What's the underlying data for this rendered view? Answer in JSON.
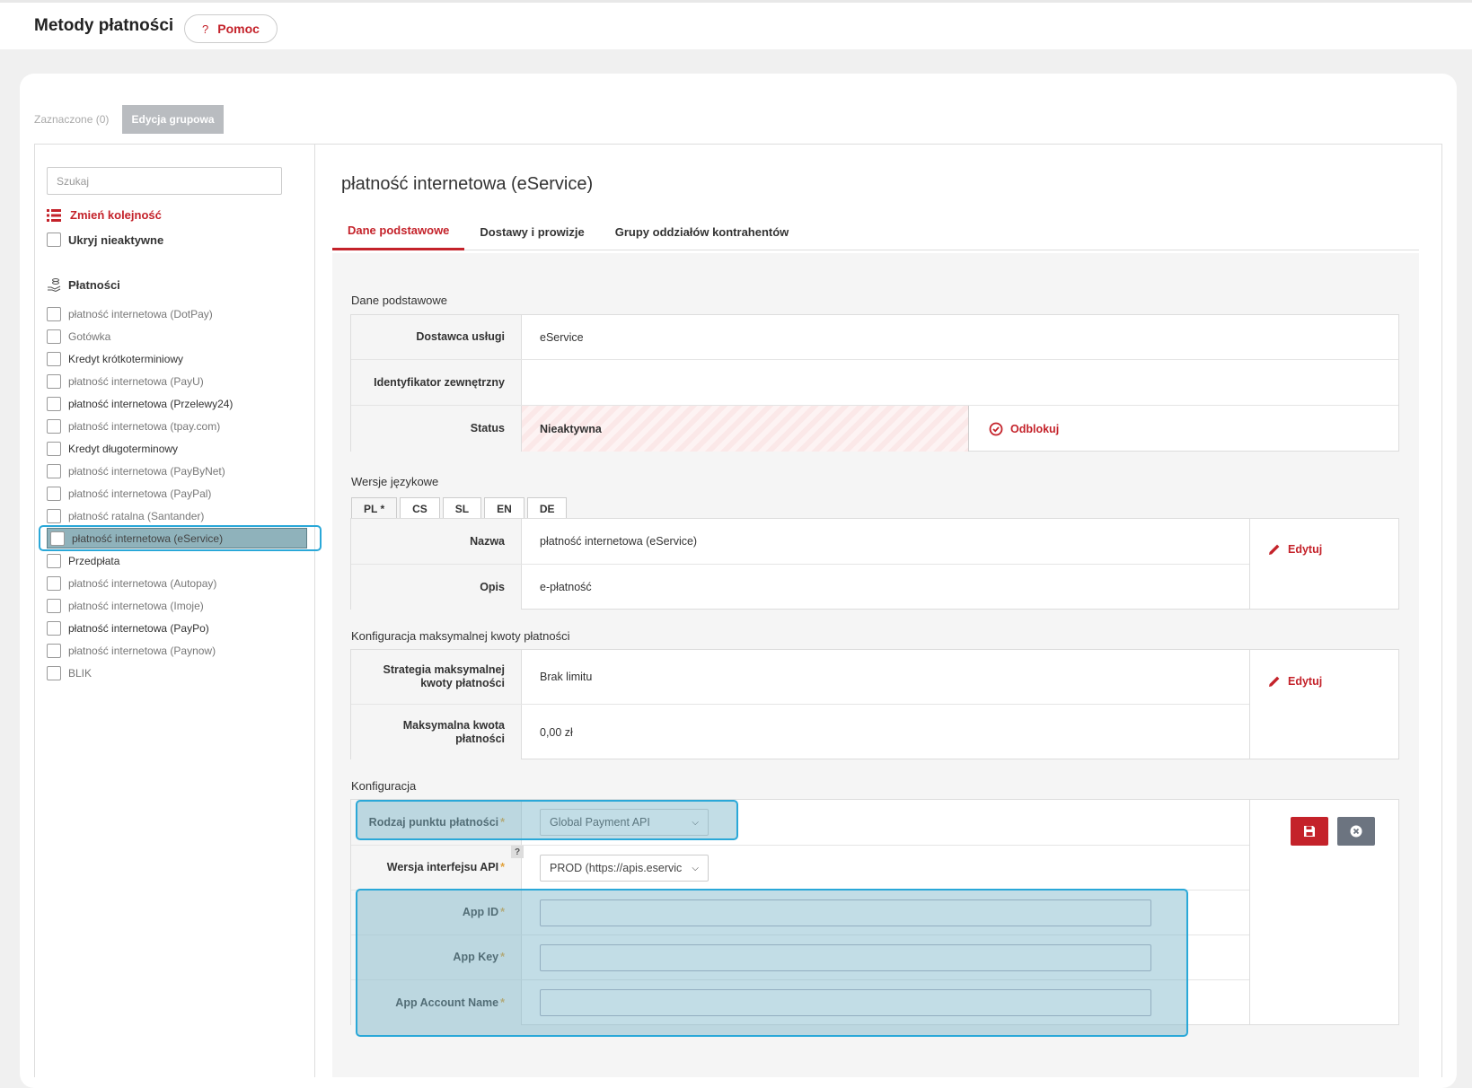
{
  "header": {
    "title": "Metody płatności",
    "help_label": "Pomoc",
    "help_icon": "?"
  },
  "toolbar": {
    "selected_label": "Zaznaczone (0)",
    "group_edit_label": "Edycja grupowa"
  },
  "sidebar": {
    "search_placeholder": "Szukaj",
    "reorder_label": "Zmień kolejność",
    "hide_inactive_label": "Ukryj nieaktywne",
    "section_title": "Płatności",
    "items": [
      {
        "label": "płatność internetowa (DotPay)",
        "dim": true
      },
      {
        "label": "Gotówka",
        "dim": true
      },
      {
        "label": "Kredyt krótkoterminiowy",
        "dim": false
      },
      {
        "label": "płatność internetowa (PayU)",
        "dim": true
      },
      {
        "label": "płatność internetowa (Przelewy24)",
        "dim": false
      },
      {
        "label": "płatność internetowa (tpay.com)",
        "dim": true
      },
      {
        "label": "Kredyt długoterminowy",
        "dim": false
      },
      {
        "label": "płatność internetowa (PayByNet)",
        "dim": true
      },
      {
        "label": "płatność internetowa (PayPal)",
        "dim": true
      },
      {
        "label": "płatność ratalna (Santander)",
        "dim": true
      },
      {
        "label": "płatność internetowa (eService)",
        "dim": true,
        "active": true
      },
      {
        "label": "Przedpłata",
        "dim": false
      },
      {
        "label": "płatność internetowa (Autopay)",
        "dim": true
      },
      {
        "label": "płatność internetowa (Imoje)",
        "dim": true
      },
      {
        "label": "płatność internetowa (PayPo)",
        "dim": false
      },
      {
        "label": "płatność internetowa (Paynow)",
        "dim": true
      },
      {
        "label": "BLIK",
        "dim": true
      }
    ]
  },
  "detail": {
    "title": "płatność internetowa (eService)",
    "tabs": [
      "Dane podstawowe",
      "Dostawy i prowizje",
      "Grupy oddziałów kontrahentów"
    ],
    "basic": {
      "section_label": "Dane podstawowe",
      "provider_label": "Dostawca usługi",
      "provider_value": "eService",
      "external_id_label": "Identyfikator zewnętrzny",
      "external_id_value": "",
      "status_label": "Status",
      "status_value": "Nieaktywna",
      "unlock_label": "Odblokuj"
    },
    "languages": {
      "section_label": "Wersje językowe",
      "tabs": [
        "PL *",
        "CS",
        "SL",
        "EN",
        "DE"
      ],
      "name_label": "Nazwa",
      "name_value": "płatność internetowa (eService)",
      "desc_label": "Opis",
      "desc_value": "e-płatność",
      "edit_label": "Edytuj"
    },
    "max_amount": {
      "section_label": "Konfiguracja maksymalnej kwoty płatności",
      "strategy_label": "Strategia maksymalnej kwoty płatności",
      "strategy_value": "Brak limitu",
      "max_label": "Maksymalna kwota płatności",
      "max_value": "0,00 zł",
      "edit_label": "Edytuj"
    },
    "config": {
      "section_label": "Konfiguracja",
      "point_type_label": "Rodzaj punktu płatności",
      "point_type_value": "Global Payment API",
      "api_version_label": "Wersja interfejsu API",
      "api_version_value": "PROD (https://apis.eservic",
      "help_mark": "?",
      "app_id_label": "App ID",
      "app_id_value": "",
      "app_key_label": "App Key",
      "app_key_value": "",
      "app_account_label": "App Account Name",
      "app_account_value": "",
      "required_mark": "*"
    }
  },
  "colors": {
    "accent": "#c4222a",
    "highlight": "#2aa8d8",
    "cancel": "#6c7480"
  }
}
